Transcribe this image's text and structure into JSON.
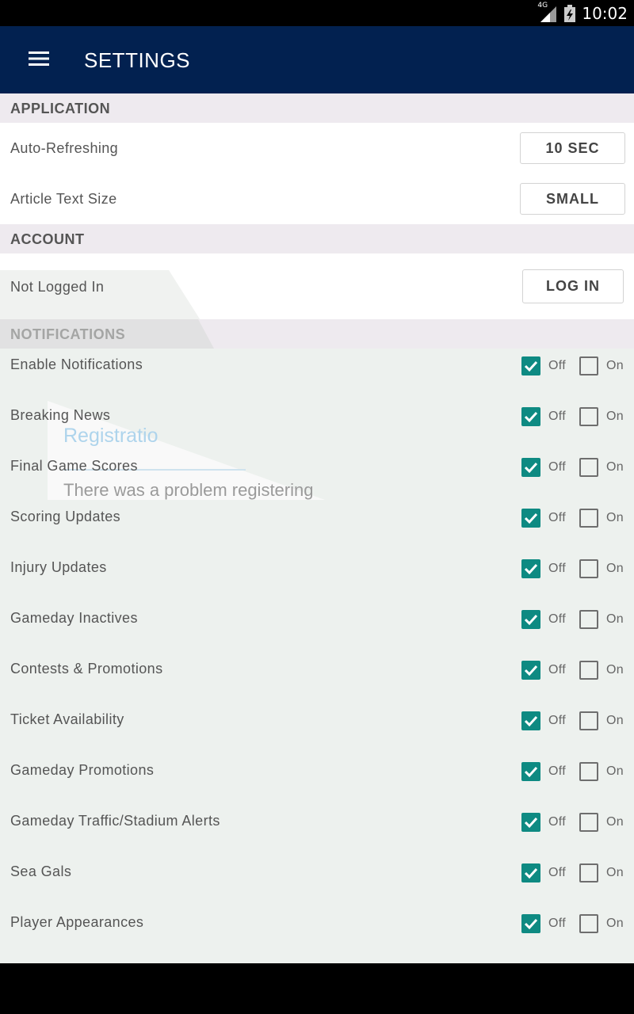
{
  "status_bar": {
    "network": "4G",
    "time": "10:02"
  },
  "app_bar": {
    "title": "SETTINGS"
  },
  "sections": {
    "application": {
      "header": "APPLICATION",
      "rows": [
        {
          "label": "Auto-Refreshing",
          "value": "10 SEC"
        },
        {
          "label": "Article Text Size",
          "value": "SMALL"
        }
      ]
    },
    "account": {
      "header": "ACCOUNT",
      "status": "Not Logged In",
      "login_label": "LOG IN"
    },
    "notifications": {
      "header": "NOTIFICATIONS",
      "off_label": "Off",
      "on_label": "On",
      "items": [
        {
          "label": "Enable Notifications",
          "off_checked": true,
          "on_checked": false
        },
        {
          "label": "Breaking News",
          "off_checked": true,
          "on_checked": false
        },
        {
          "label": "Final Game Scores",
          "off_checked": true,
          "on_checked": false
        },
        {
          "label": "Scoring Updates",
          "off_checked": true,
          "on_checked": false
        },
        {
          "label": "Injury Updates",
          "off_checked": true,
          "on_checked": false
        },
        {
          "label": "Gameday Inactives",
          "off_checked": true,
          "on_checked": false
        },
        {
          "label": "Contests & Promotions",
          "off_checked": true,
          "on_checked": false
        },
        {
          "label": "Ticket Availability",
          "off_checked": true,
          "on_checked": false
        },
        {
          "label": "Gameday Promotions",
          "off_checked": true,
          "on_checked": false
        },
        {
          "label": "Gameday Traffic/Stadium Alerts",
          "off_checked": true,
          "on_checked": false
        },
        {
          "label": "Sea Gals",
          "off_checked": true,
          "on_checked": false
        },
        {
          "label": "Player Appearances",
          "off_checked": true,
          "on_checked": false
        }
      ]
    }
  },
  "ghost_dialog": {
    "title": "Registratio",
    "message": "There was a problem registering"
  },
  "colors": {
    "app_bar": "#022150",
    "checkbox_checked": "#0e8a82",
    "section_header_bg": "#eeeaef",
    "notifications_bg": "#edf1ee"
  },
  "icons": {
    "menu": "menu-icon",
    "signal": "signal-icon",
    "battery": "battery-icon",
    "check": "check-icon"
  }
}
